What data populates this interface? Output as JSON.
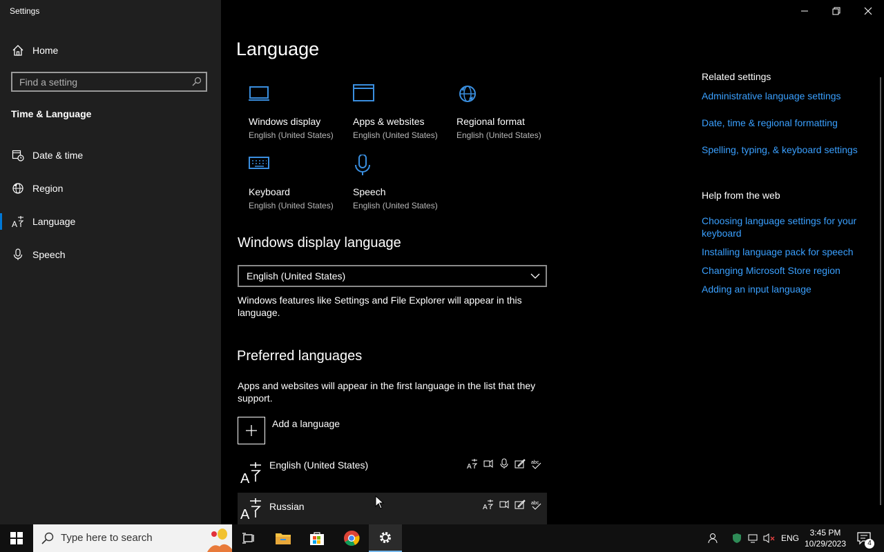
{
  "window": {
    "title": "Settings"
  },
  "sidebar": {
    "home": "Home",
    "search_placeholder": "Find a setting",
    "section_title": "Time & Language",
    "items": [
      {
        "label": "Date & time",
        "icon": "calendar-clock-icon"
      },
      {
        "label": "Region",
        "icon": "globe-icon"
      },
      {
        "label": "Language",
        "icon": "language-icon",
        "selected": true
      },
      {
        "label": "Speech",
        "icon": "microphone-icon"
      }
    ]
  },
  "main": {
    "title": "Language",
    "tiles": [
      {
        "title": "Windows display",
        "subtitle": "English (United States)",
        "icon": "monitor-icon"
      },
      {
        "title": "Apps & websites",
        "subtitle": "English (United States)",
        "icon": "app-window-icon"
      },
      {
        "title": "Regional format",
        "subtitle": "English (United States)",
        "icon": "globe-icon"
      },
      {
        "title": "Keyboard",
        "subtitle": "English (United States)",
        "icon": "keyboard-icon"
      },
      {
        "title": "Speech",
        "subtitle": "English (United States)",
        "icon": "microphone-icon"
      }
    ],
    "display_language": {
      "heading": "Windows display language",
      "selected": "English (United States)",
      "description": "Windows features like Settings and File Explorer will appear in this language."
    },
    "preferred": {
      "heading": "Preferred languages",
      "description": "Apps and websites will appear in the first language in the list that they support.",
      "add_label": "Add a language",
      "languages": [
        {
          "name": "English (United States)"
        },
        {
          "name": "Russian"
        }
      ]
    }
  },
  "related": {
    "heading": "Related settings",
    "links": [
      "Administrative language settings",
      "Date, time & regional formatting",
      "Spelling, typing, & keyboard settings"
    ]
  },
  "help": {
    "heading": "Help from the web",
    "links": [
      "Choosing language settings for your keyboard",
      "Installing language pack for speech",
      "Changing Microsoft Store region",
      "Adding an input language"
    ]
  },
  "taskbar": {
    "search_placeholder": "Type here to search",
    "language": "ENG",
    "time": "3:45 PM",
    "date": "10/29/2023",
    "notification_count": "4"
  },
  "colors": {
    "accent": "#0078d7",
    "link": "#3aa0ff",
    "sidebar_bg": "#1f1f1f"
  }
}
